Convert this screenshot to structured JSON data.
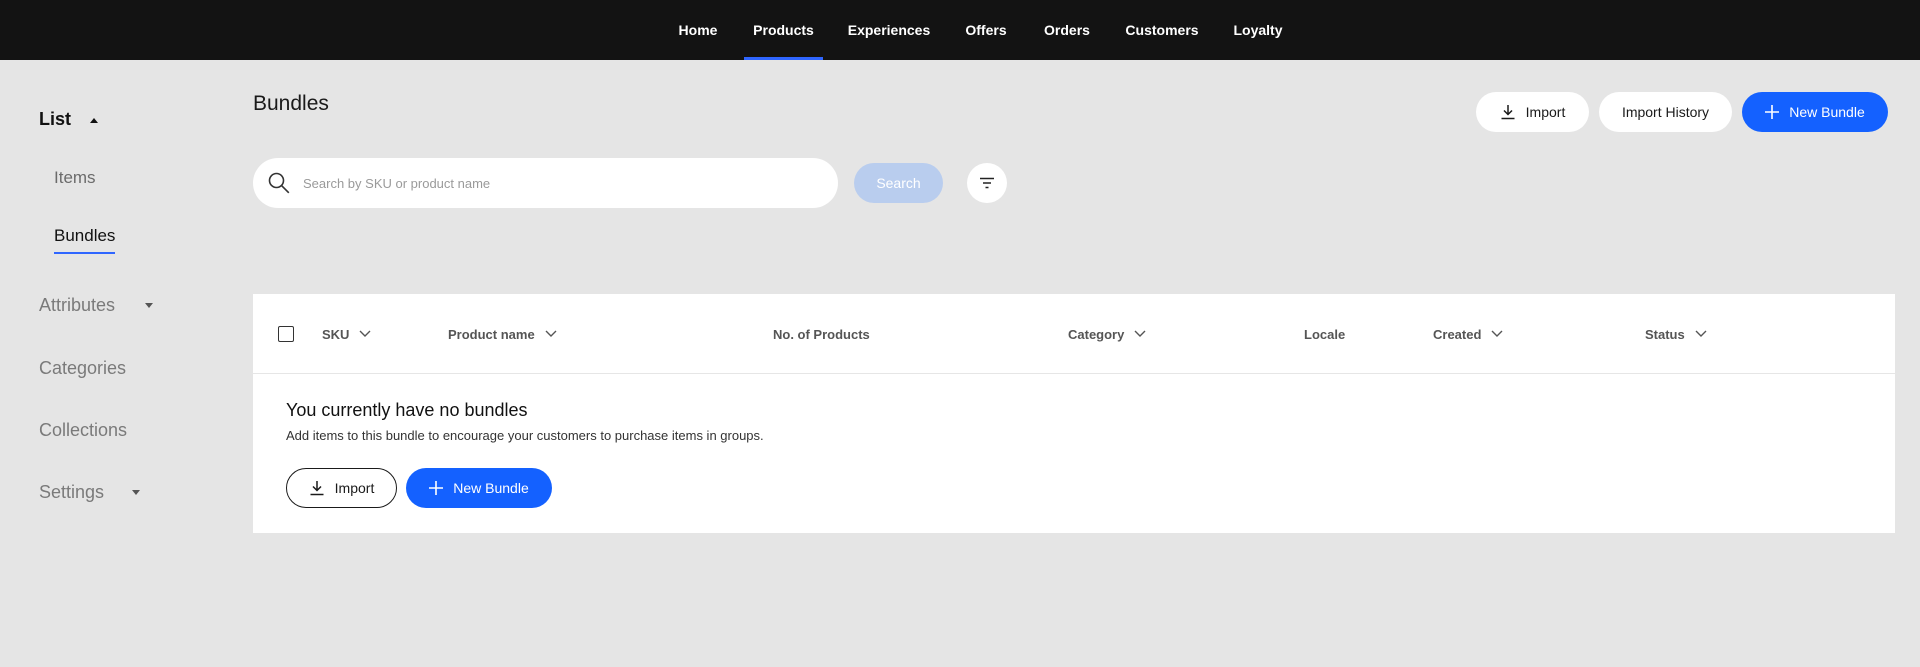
{
  "nav": {
    "items": [
      {
        "label": "Home",
        "active": false
      },
      {
        "label": "Products",
        "active": true
      },
      {
        "label": "Experiences",
        "active": false
      },
      {
        "label": "Offers",
        "active": false
      },
      {
        "label": "Orders",
        "active": false
      },
      {
        "label": "Customers",
        "active": false
      },
      {
        "label": "Loyalty",
        "active": false
      }
    ],
    "accent": "#2f66ff"
  },
  "sidebar": {
    "list_label": "List",
    "sub_items": [
      {
        "label": "Items",
        "active": false
      },
      {
        "label": "Bundles",
        "active": true
      }
    ],
    "attributes_label": "Attributes",
    "categories_label": "Categories",
    "collections_label": "Collections",
    "settings_label": "Settings"
  },
  "page": {
    "title": "Bundles",
    "import_label": "Import",
    "import_history_label": "Import History",
    "new_bundle_label": "New Bundle"
  },
  "search": {
    "placeholder": "Search by SKU or product name",
    "value": "",
    "button_label": "Search"
  },
  "table": {
    "columns": [
      {
        "label": "SKU",
        "sortable": true
      },
      {
        "label": "Product name",
        "sortable": true
      },
      {
        "label": "No. of Products",
        "sortable": false
      },
      {
        "label": "Category",
        "sortable": true
      },
      {
        "label": "Locale",
        "sortable": false
      },
      {
        "label": "Created",
        "sortable": true
      },
      {
        "label": "Status",
        "sortable": true
      }
    ],
    "rows": []
  },
  "empty_state": {
    "title": "You currently have no bundles",
    "description": "Add items to this bundle to encourage your customers to purchase items in groups.",
    "import_label": "Import",
    "new_bundle_label": "New Bundle"
  },
  "colors": {
    "primary": "#1461ff",
    "nav_bg": "#131313",
    "page_bg": "#e5e5e5",
    "search_disabled": "#b9cdee"
  }
}
